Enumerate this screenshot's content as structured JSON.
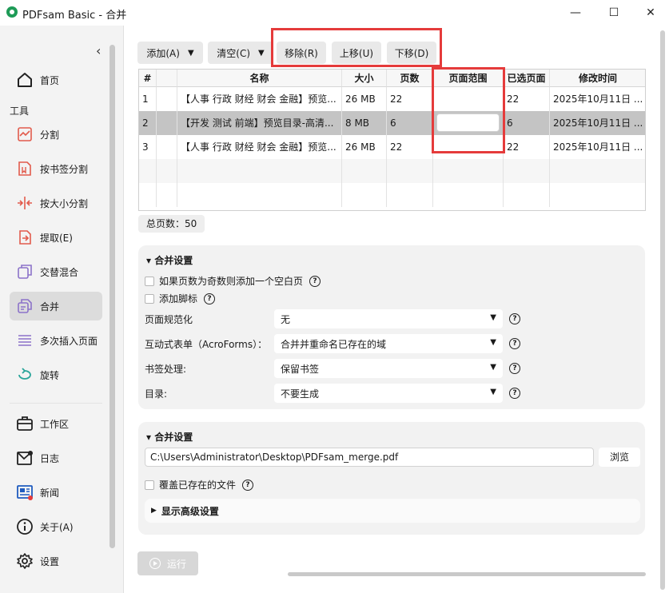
{
  "window": {
    "title": "PDFsam Basic - 合并",
    "minimize": "—",
    "maximize": "☐",
    "close": "✕"
  },
  "sidebar": {
    "collapse_glyph": "‹",
    "home": {
      "label": "首页",
      "icon": "home-icon"
    },
    "section_title": "工具",
    "tools": [
      {
        "label": "分割",
        "icon": "split-icon"
      },
      {
        "label": "按书签分割",
        "icon": "bookmark-split-icon"
      },
      {
        "label": "按大小分割",
        "icon": "size-split-icon"
      },
      {
        "label": "提取(E)",
        "icon": "extract-icon"
      },
      {
        "label": "交替混合",
        "icon": "alternate-mix-icon"
      },
      {
        "label": "合并",
        "icon": "merge-icon",
        "active": true
      },
      {
        "label": "多次插入页面",
        "icon": "insert-pages-icon"
      },
      {
        "label": "旋转",
        "icon": "rotate-icon"
      }
    ],
    "bottom": [
      {
        "label": "工作区",
        "icon": "briefcase-icon"
      },
      {
        "label": "日志",
        "icon": "log-icon"
      },
      {
        "label": "新闻",
        "icon": "news-icon"
      },
      {
        "label": "关于(A)",
        "icon": "info-icon"
      },
      {
        "label": "设置",
        "icon": "gear-icon"
      }
    ]
  },
  "toolbar": {
    "add": "添加(A)",
    "clear": "清空(C)",
    "remove": "移除(R)",
    "move_up": "上移(U)",
    "move_down": "下移(D)",
    "dropdown_glyph": "▼"
  },
  "table": {
    "headers": [
      "#",
      "",
      "名称",
      "大小",
      "页数",
      "页面范围",
      "已选页面",
      "修改时间"
    ],
    "rows": [
      {
        "num": "1",
        "name": "【人事 行政 财经 财会 金融】预览...",
        "size": "26 MB",
        "pages": "22",
        "range": "",
        "selected": "22",
        "modified": "2025年10月11日 ..."
      },
      {
        "num": "2",
        "name": "【开发 测试 前端】预览目录-高清...",
        "size": "8 MB",
        "pages": "6",
        "range": "",
        "selected": "6",
        "modified": "2025年10月11日 ..."
      },
      {
        "num": "3",
        "name": "【人事 行政 财经 财会 金融】预览...",
        "size": "26 MB",
        "pages": "22",
        "range": "",
        "selected": "22",
        "modified": "2025年10月11日 ..."
      }
    ],
    "selected_row": 2
  },
  "total_pages": "总页数：50",
  "merge_settings": {
    "title": "合并设置",
    "blank_page": "如果页数为奇数则添加一个空白页",
    "footer": "添加脚标",
    "normalize_label": "页面规范化",
    "normalize_value": "无",
    "forms_label": "互动式表单（AcroForms）：",
    "forms_value": "合并并重命名已存在的域",
    "bookmarks_label": "书签处理:",
    "bookmarks_value": "保留书签",
    "toc_label": "目录:",
    "toc_value": "不要生成"
  },
  "output_settings": {
    "title": "合并设置",
    "path": "C:\\Users\\Administrator\\Desktop\\PDFsam_merge.pdf",
    "browse": "浏览",
    "overwrite": "覆盖已存在的文件",
    "advanced": "显示高级设置"
  },
  "run": "运行",
  "colors": {
    "highlight": "#e53b3b",
    "selected_row": "#c4c4c4",
    "brand": "#1e9b57"
  }
}
